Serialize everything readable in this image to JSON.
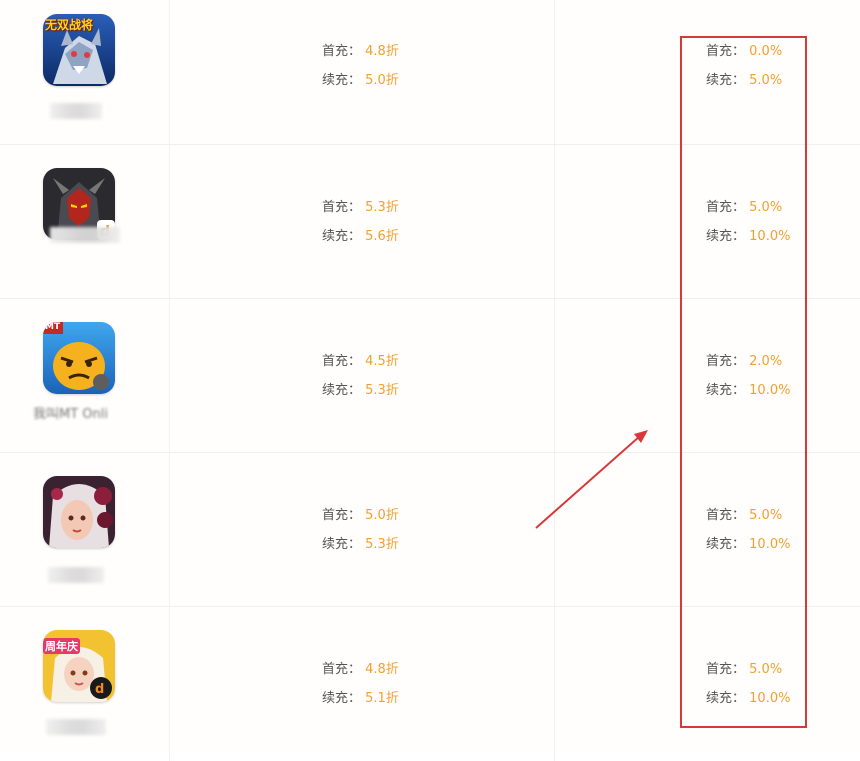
{
  "labels": {
    "first": "首充：",
    "renew": "续充："
  },
  "rows": [
    {
      "icon": "wolf-game-icon",
      "icon_text": "无双战将",
      "name": "",
      "discount": {
        "first": "4.8折",
        "renew": "5.0折"
      },
      "rebate": {
        "first": "0.0%",
        "renew": "5.0%"
      }
    },
    {
      "icon": "demon-warrior-game-icon",
      "icon_text": "",
      "name": "",
      "discount": {
        "first": "5.3折",
        "renew": "5.6折"
      },
      "rebate": {
        "first": "5.0%",
        "renew": "10.0%"
      }
    },
    {
      "icon": "yellow-creature-game-icon",
      "icon_text": "MT",
      "name": "我叫MT Onli",
      "discount": {
        "first": "4.5折",
        "renew": "5.3折"
      },
      "rebate": {
        "first": "2.0%",
        "renew": "10.0%"
      }
    },
    {
      "icon": "girl-portrait-game-icon",
      "icon_text": "",
      "name": "",
      "discount": {
        "first": "5.0折",
        "renew": "5.3折"
      },
      "rebate": {
        "first": "5.0%",
        "renew": "10.0%"
      }
    },
    {
      "icon": "anniversary-girl-game-icon",
      "icon_text": "周年庆",
      "name": "",
      "discount": {
        "first": "4.8折",
        "renew": "5.1折"
      },
      "rebate": {
        "first": "5.0%",
        "renew": "10.0%"
      }
    }
  ],
  "colors": {
    "value": "#f0a030",
    "label": "#555555",
    "highlight": "#d8383a"
  }
}
